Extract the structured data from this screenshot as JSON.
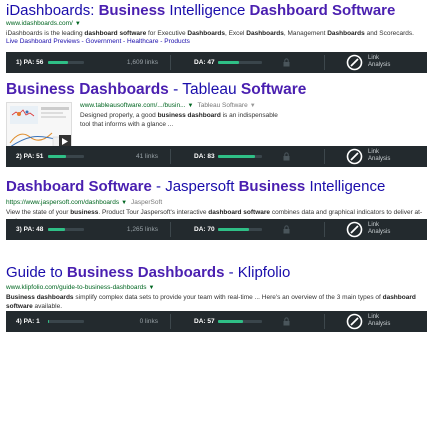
{
  "results": [
    {
      "title_parts": [
        "iDashboards: ",
        "Business",
        " Intelligence ",
        "Dashboard Software"
      ],
      "url": "www.idashboards.com/",
      "snippet": "iDashboards is the leading dashboard software for Executive Dashboards, Excel Dashboards, Management Dashboards and Scorecards.",
      "sitelinks": "Live Dashboard Previews - Government - Healthcare - Products",
      "moz": {
        "pa_label": "1) PA: 56",
        "pa": 56,
        "links": "1,609 links",
        "da_label": "DA: 47",
        "da": 47,
        "la1": "Link",
        "la2": "Analysis"
      }
    },
    {
      "title_parts": [
        "Business Dashboards",
        " - Tableau ",
        "Software"
      ],
      "url": "www.tableausoftware.com/.../busin...",
      "source": "Tableau Software",
      "snippet": "Designed properly, a good business dashboard is an indispensable tool that informs with a glance ...",
      "moz": {
        "pa_label": "2) PA: 51",
        "pa": 51,
        "links": "41 links",
        "da_label": "DA: 83",
        "da": 83,
        "la1": "Link",
        "la2": "Analysis"
      }
    },
    {
      "title_parts": [
        "Dashboard Software",
        " - Jaspersoft ",
        "Business",
        " Intelligence"
      ],
      "url": "https://www.jaspersoft.com/dashboards",
      "source": "JasperSoft",
      "snippet": "View the state of your business. Product Tour Jaspersoft's interactive dashboard software combines data and graphical indicators to deliver at-a-glance ...",
      "moz": {
        "pa_label": "3) PA: 48",
        "pa": 48,
        "links": "1,265 links",
        "da_label": "DA: 70",
        "da": 70,
        "la1": "Link",
        "la2": "Analysis"
      }
    },
    {
      "title_parts": [
        "Guide to ",
        "Business Dashboards",
        " - Klipfolio"
      ],
      "url": "www.klipfolio.com/guide-to-business-dashboards",
      "snippet": "Business dashboards simplify complex data sets to provide your team with real-time ... Here's an overview of the 3 main types of dashboard software available.",
      "moz": {
        "pa_label": "4) PA: 1",
        "pa": 1,
        "links": "0 links",
        "da_label": "DA: 57",
        "da": 57,
        "la1": "Link",
        "la2": "Analysis"
      }
    }
  ],
  "colors": {
    "title": "#1a0dab",
    "url": "#006621",
    "mozbar": "#232a2e",
    "accent": "#2fbf86"
  }
}
